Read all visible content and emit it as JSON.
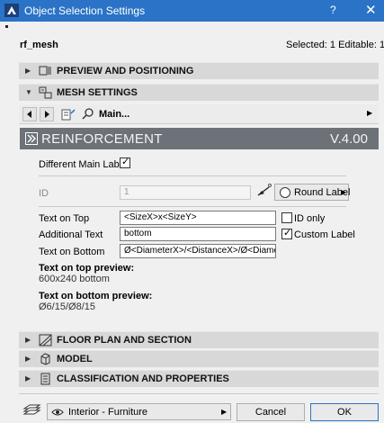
{
  "window": {
    "title": "Object Selection Settings",
    "help": "?",
    "close": "✕"
  },
  "header": {
    "object_name": "rf_mesh",
    "selection_info": "Selected: 1 Editable: 1"
  },
  "sections": {
    "preview": "PREVIEW AND POSITIONING",
    "mesh": "MESH SETTINGS",
    "floor_plan": "FLOOR PLAN AND SECTION",
    "model": "MODEL",
    "classification": "CLASSIFICATION AND PROPERTIES"
  },
  "toolbar": {
    "main_label": "Main..."
  },
  "banner": {
    "title": "REINFORCEMENT",
    "version": "V.4.00"
  },
  "form": {
    "different_main_label": "Different Main Label",
    "different_main_label_checked": true,
    "id_label": "ID",
    "id_value": "1",
    "round_label_button": "Round Label",
    "text_on_top_label": "Text on Top",
    "text_on_top_value": "<SizeX>x<SizeY>",
    "id_only_label": "ID only",
    "id_only_checked": false,
    "additional_text_label": "Additional Text",
    "additional_text_value": "bottom",
    "custom_label_label": "Custom Label",
    "custom_label_checked": true,
    "text_on_bottom_label": "Text on Bottom",
    "text_on_bottom_value": "Ø<DiameterX>/<DistanceX>/Ø<Diamete"
  },
  "previews": {
    "top_heading": "Text on top preview:",
    "top_value": "600x240 bottom",
    "bottom_heading": "Text on bottom preview:",
    "bottom_value": "Ø6/15/Ø8/15"
  },
  "footer": {
    "layer_value": "Interior - Furniture",
    "cancel_label": "Cancel",
    "ok_label": "OK"
  }
}
